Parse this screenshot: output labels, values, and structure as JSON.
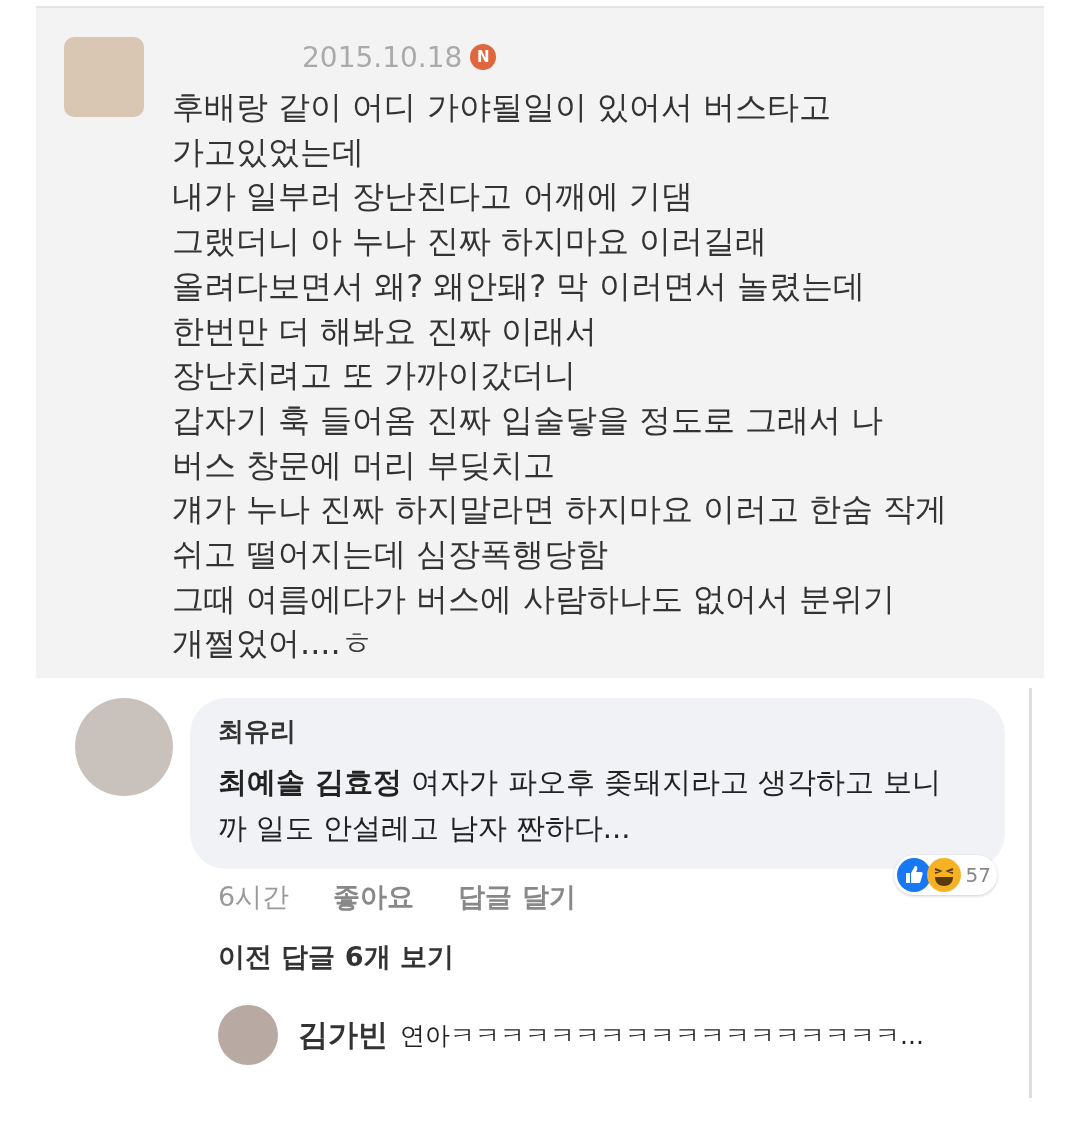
{
  "post": {
    "date": "2015.10.18",
    "new_badge": "N",
    "lines": [
      "후배랑 같이 어디 가야될일이 있어서 버스타고",
      "가고있었는데",
      "내가 일부러 장난친다고 어깨에 기댐",
      "그랬더니 아 누나 진짜 하지마요 이러길래",
      "올려다보면서 왜? 왜안돼? 막 이러면서 놀렸는데",
      "한번만 더 해봐요 진짜 이래서",
      "장난치려고 또 가까이갔더니",
      "갑자기 훅 들어옴 진짜 입술닿을 정도로 그래서 나",
      "버스 창문에 머리 부딪치고",
      "걔가 누나 진짜 하지말라면 하지마요 이러고 한숨 작게",
      "쉬고 떨어지는데 심장폭행당함",
      "그때 여름에다가 버스에 사람하나도 없어서 분위기",
      "개쩔었어....ㅎ"
    ]
  },
  "comment": {
    "author": "최유리",
    "text": "**최예솔 김효정** 여자가 파오후 좆돼지라고 생각하고 보니까 일도 안설레고 남자 짠하다...",
    "time": "6시간",
    "actions": [
      "좋아요",
      "답글 달기"
    ],
    "reaction_count": "57"
  },
  "view_previous": "이전 답글 6개 보기",
  "reply": {
    "author": "김가빈",
    "text": "연아ㅋㅋㅋㅋㅋㅋㅋㅋㅋㅋㅋㅋㅋㅋㅋㅋㅋㅋ..."
  }
}
